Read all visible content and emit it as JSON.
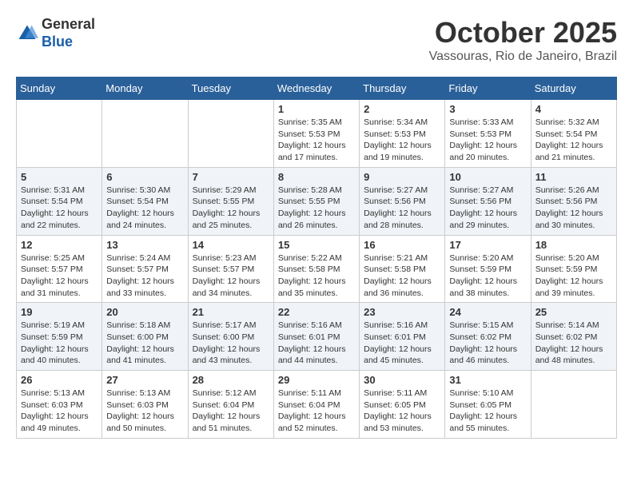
{
  "header": {
    "logo_general": "General",
    "logo_blue": "Blue",
    "month_title": "October 2025",
    "location": "Vassouras, Rio de Janeiro, Brazil"
  },
  "days_of_week": [
    "Sunday",
    "Monday",
    "Tuesday",
    "Wednesday",
    "Thursday",
    "Friday",
    "Saturday"
  ],
  "weeks": [
    [
      {
        "day": "",
        "info": ""
      },
      {
        "day": "",
        "info": ""
      },
      {
        "day": "",
        "info": ""
      },
      {
        "day": "1",
        "info": "Sunrise: 5:35 AM\nSunset: 5:53 PM\nDaylight: 12 hours and 17 minutes."
      },
      {
        "day": "2",
        "info": "Sunrise: 5:34 AM\nSunset: 5:53 PM\nDaylight: 12 hours and 19 minutes."
      },
      {
        "day": "3",
        "info": "Sunrise: 5:33 AM\nSunset: 5:53 PM\nDaylight: 12 hours and 20 minutes."
      },
      {
        "day": "4",
        "info": "Sunrise: 5:32 AM\nSunset: 5:54 PM\nDaylight: 12 hours and 21 minutes."
      }
    ],
    [
      {
        "day": "5",
        "info": "Sunrise: 5:31 AM\nSunset: 5:54 PM\nDaylight: 12 hours and 22 minutes."
      },
      {
        "day": "6",
        "info": "Sunrise: 5:30 AM\nSunset: 5:54 PM\nDaylight: 12 hours and 24 minutes."
      },
      {
        "day": "7",
        "info": "Sunrise: 5:29 AM\nSunset: 5:55 PM\nDaylight: 12 hours and 25 minutes."
      },
      {
        "day": "8",
        "info": "Sunrise: 5:28 AM\nSunset: 5:55 PM\nDaylight: 12 hours and 26 minutes."
      },
      {
        "day": "9",
        "info": "Sunrise: 5:27 AM\nSunset: 5:56 PM\nDaylight: 12 hours and 28 minutes."
      },
      {
        "day": "10",
        "info": "Sunrise: 5:27 AM\nSunset: 5:56 PM\nDaylight: 12 hours and 29 minutes."
      },
      {
        "day": "11",
        "info": "Sunrise: 5:26 AM\nSunset: 5:56 PM\nDaylight: 12 hours and 30 minutes."
      }
    ],
    [
      {
        "day": "12",
        "info": "Sunrise: 5:25 AM\nSunset: 5:57 PM\nDaylight: 12 hours and 31 minutes."
      },
      {
        "day": "13",
        "info": "Sunrise: 5:24 AM\nSunset: 5:57 PM\nDaylight: 12 hours and 33 minutes."
      },
      {
        "day": "14",
        "info": "Sunrise: 5:23 AM\nSunset: 5:57 PM\nDaylight: 12 hours and 34 minutes."
      },
      {
        "day": "15",
        "info": "Sunrise: 5:22 AM\nSunset: 5:58 PM\nDaylight: 12 hours and 35 minutes."
      },
      {
        "day": "16",
        "info": "Sunrise: 5:21 AM\nSunset: 5:58 PM\nDaylight: 12 hours and 36 minutes."
      },
      {
        "day": "17",
        "info": "Sunrise: 5:20 AM\nSunset: 5:59 PM\nDaylight: 12 hours and 38 minutes."
      },
      {
        "day": "18",
        "info": "Sunrise: 5:20 AM\nSunset: 5:59 PM\nDaylight: 12 hours and 39 minutes."
      }
    ],
    [
      {
        "day": "19",
        "info": "Sunrise: 5:19 AM\nSunset: 5:59 PM\nDaylight: 12 hours and 40 minutes."
      },
      {
        "day": "20",
        "info": "Sunrise: 5:18 AM\nSunset: 6:00 PM\nDaylight: 12 hours and 41 minutes."
      },
      {
        "day": "21",
        "info": "Sunrise: 5:17 AM\nSunset: 6:00 PM\nDaylight: 12 hours and 43 minutes."
      },
      {
        "day": "22",
        "info": "Sunrise: 5:16 AM\nSunset: 6:01 PM\nDaylight: 12 hours and 44 minutes."
      },
      {
        "day": "23",
        "info": "Sunrise: 5:16 AM\nSunset: 6:01 PM\nDaylight: 12 hours and 45 minutes."
      },
      {
        "day": "24",
        "info": "Sunrise: 5:15 AM\nSunset: 6:02 PM\nDaylight: 12 hours and 46 minutes."
      },
      {
        "day": "25",
        "info": "Sunrise: 5:14 AM\nSunset: 6:02 PM\nDaylight: 12 hours and 48 minutes."
      }
    ],
    [
      {
        "day": "26",
        "info": "Sunrise: 5:13 AM\nSunset: 6:03 PM\nDaylight: 12 hours and 49 minutes."
      },
      {
        "day": "27",
        "info": "Sunrise: 5:13 AM\nSunset: 6:03 PM\nDaylight: 12 hours and 50 minutes."
      },
      {
        "day": "28",
        "info": "Sunrise: 5:12 AM\nSunset: 6:04 PM\nDaylight: 12 hours and 51 minutes."
      },
      {
        "day": "29",
        "info": "Sunrise: 5:11 AM\nSunset: 6:04 PM\nDaylight: 12 hours and 52 minutes."
      },
      {
        "day": "30",
        "info": "Sunrise: 5:11 AM\nSunset: 6:05 PM\nDaylight: 12 hours and 53 minutes."
      },
      {
        "day": "31",
        "info": "Sunrise: 5:10 AM\nSunset: 6:05 PM\nDaylight: 12 hours and 55 minutes."
      },
      {
        "day": "",
        "info": ""
      }
    ]
  ]
}
